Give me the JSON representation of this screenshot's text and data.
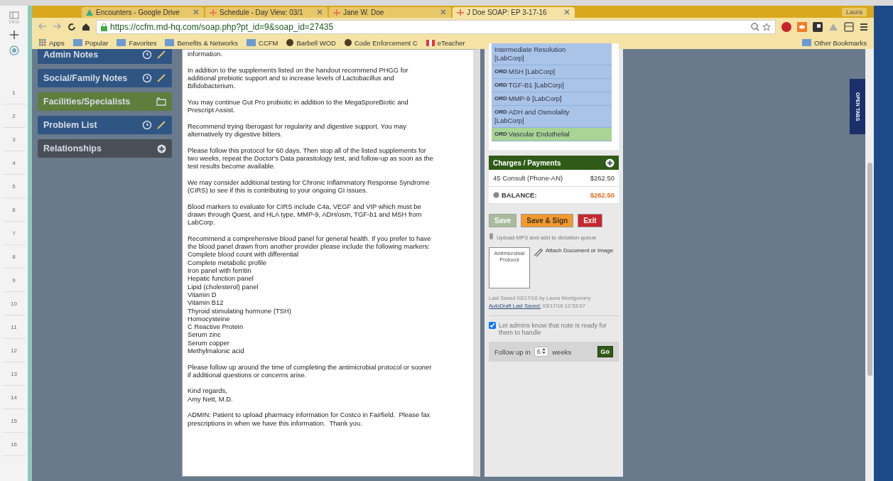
{
  "browser": {
    "tabs": [
      {
        "label": "Encounters - Google Drive",
        "selected": false
      },
      {
        "label": "Schedule - Day View: 03/1",
        "selected": false
      },
      {
        "label": "Jane W. Doe",
        "selected": false
      },
      {
        "label": "J Doe SOAP: EP 3-17-16",
        "selected": true
      }
    ],
    "profile": "Laura",
    "url": "https://ccfm.md-hq.com/soap.php?pt_id=9&soap_id=27435",
    "bookmarks": [
      {
        "label": "Apps",
        "kind": "apps"
      },
      {
        "label": "Popular",
        "kind": "folder"
      },
      {
        "label": "Favorites",
        "kind": "folder"
      },
      {
        "label": "Benefits & Networks",
        "kind": "folder"
      },
      {
        "label": "CCFM",
        "kind": "folder"
      },
      {
        "label": "Barbell WOD",
        "kind": "site"
      },
      {
        "label": "Code Enforcement C",
        "kind": "site"
      },
      {
        "label": "eTeacher",
        "kind": "flag"
      }
    ],
    "other_bookmarks": "Other Bookmarks"
  },
  "gutter": {
    "view_label": "View",
    "rows": [
      "1",
      "2",
      "3",
      "4",
      "5",
      "6",
      "7",
      "8",
      "9",
      "10",
      "11",
      "12",
      "13",
      "14",
      "15",
      "16"
    ]
  },
  "sidebar": [
    {
      "label": "Admin Notes",
      "kind": "history",
      "color": "#2f5583"
    },
    {
      "label": "Social/Family Notes",
      "kind": "history",
      "color": "#2f5583"
    },
    {
      "label": "Facilities/Specialists",
      "kind": "folder",
      "color": "#5f7d3b"
    },
    {
      "label": "Problem List",
      "kind": "history",
      "color": "#2f5583"
    },
    {
      "label": "Relationships",
      "kind": "add",
      "color": "#4a4f57"
    }
  ],
  "note": [
    "information.",
    "In addition to the supplements listed on the handout recommend PHGG for\nadditional prebiotic support and to increase levels of Lactobacillus and\nBifidobacterium.",
    "You may continue Gut Pro probiotic in addition to the MegaSporeBiotic and\nPrescript Assist.",
    "Recommend trying Iberogast for regularity and digestive support. You may\nalternatively try digestive bitters.",
    "Please follow this protocol for 60 days. Then stop all of the listed supplements for\ntwo weeks, repeat the Doctor's Data parasitology test, and follow-up as soon as the\ntest results become available.",
    "We may consider additional testing for Chronic Inflammatory Response Syndrome\n(CIRS) to see if this is contributing to your ongoing GI issues.",
    "Blood markers to evaluate for CIRS include C4a, VEGF and VIP which must be\ndrawn through Quest, and HLA type, MMP-9, ADH/osm, TGF-b1 and MSH from\nLabCorp.",
    "Recommend a comprehensive blood panel for general health. If you prefer to have\nthe blood panel drawn from another provider please include the following markers:\nComplete blood count with differential\nComplete metabolic profile\nIron panel with ferritin\nHepatic function panel\nLipid (cholesterol) panel\nVitamin D\nVitamin B12\nThyroid stimulating hormone (TSH)\nHomocysteine\nC Reactive Protein\nSerum zinc\nSerum copper\nMethylmalonic acid",
    "Please follow up around the time of completing the antimicrobial protocol or sooner\nif additional questions or concerns arise.",
    "Kind regards,\nAmy Nett, M.D.",
    "ADMIN: Patient to upload pharmacy information for Costco in Fairfield.  Please fax\nprescriptions in when we have this information.  Thank you."
  ],
  "orders": [
    {
      "text": "Intermediate Resolution\n[LabCorp]",
      "color": "#a9c4e8"
    },
    {
      "tag": "ORD",
      "text": "MSH [LabCorp]",
      "color": "#a9c4e8"
    },
    {
      "tag": "ORD",
      "text": "TGF-B1 [LabCorp]",
      "color": "#a9c4e8"
    },
    {
      "tag": "ORD",
      "text": "MMP-9 [LabCorp]",
      "color": "#a9c4e8"
    },
    {
      "tag": "ORD",
      "text": "ADH and Osmolality\n[LabCorp]",
      "color": "#a9c4e8"
    },
    {
      "tag": "ORD",
      "text": "Vascular Endothelial",
      "color": "#a8d494"
    }
  ],
  "charges": {
    "title": "Charges / Payments",
    "items": [
      {
        "label": "45 Consult (Phone-AN)",
        "amount": "$262.50"
      }
    ],
    "balance_label": "BALANCE:",
    "balance": "$262.50"
  },
  "actions": [
    {
      "label": "Save",
      "kind": "save",
      "disabled": true
    },
    {
      "label": "Save & Sign",
      "kind": "sign",
      "disabled": false
    },
    {
      "label": "Exit",
      "kind": "exit",
      "disabled": false
    }
  ],
  "upload_label": "Upload MP3 and add to dictation queue",
  "attachment": {
    "thumb_title": "Antimicrobial\nProtocol",
    "link": "Attach Document or Image"
  },
  "last_saved": "Last Saved 03/17/16 by Laura Montgomery",
  "autodraft": {
    "label": "AutoDraft Last Saved:",
    "time": "03/17/16 12:53:07"
  },
  "notify": {
    "label": "Let admins know that note is ready for them to handle",
    "checked": true
  },
  "follow_up": {
    "prefix": "Follow up in",
    "value": "6",
    "suffix": "weeks",
    "button": "Go"
  },
  "open_tabs": "OPEN TABS"
}
